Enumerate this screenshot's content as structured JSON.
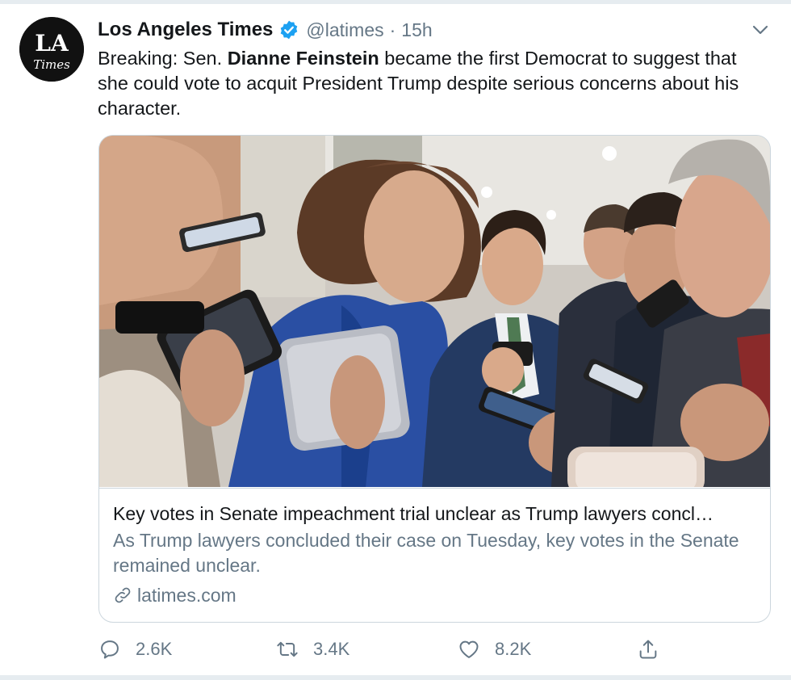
{
  "tweet": {
    "author": {
      "display_name": "Los Angeles Times",
      "handle": "@latimes",
      "verified": true,
      "avatar_text_top": "LA",
      "avatar_text_bottom": "Times"
    },
    "separator": "·",
    "timestamp": "15h",
    "text_prefix": "Breaking: Sen. ",
    "text_bold": "Dianne Feinstein",
    "text_suffix": " became the first Democrat to suggest that she could vote to acquit President Trump despite serious concerns about his character."
  },
  "card": {
    "title": "Key votes in Senate impeachment trial unclear as Trump lawyers concl…",
    "description": "As Trump lawyers concluded their case on Tuesday, key votes in the Senate remained unclear.",
    "domain": "latimes.com"
  },
  "actions": {
    "replies": "2.6K",
    "retweets": "3.4K",
    "likes": "8.2K"
  },
  "icons": {
    "verified": "verified-badge-icon",
    "menu": "chevron-down-icon",
    "link": "link-icon",
    "reply": "reply-icon",
    "retweet": "retweet-icon",
    "like": "heart-icon",
    "share": "share-icon"
  },
  "colors": {
    "accent": "#1da1f2",
    "secondary_text": "#657786",
    "border": "#ccd6dd"
  }
}
